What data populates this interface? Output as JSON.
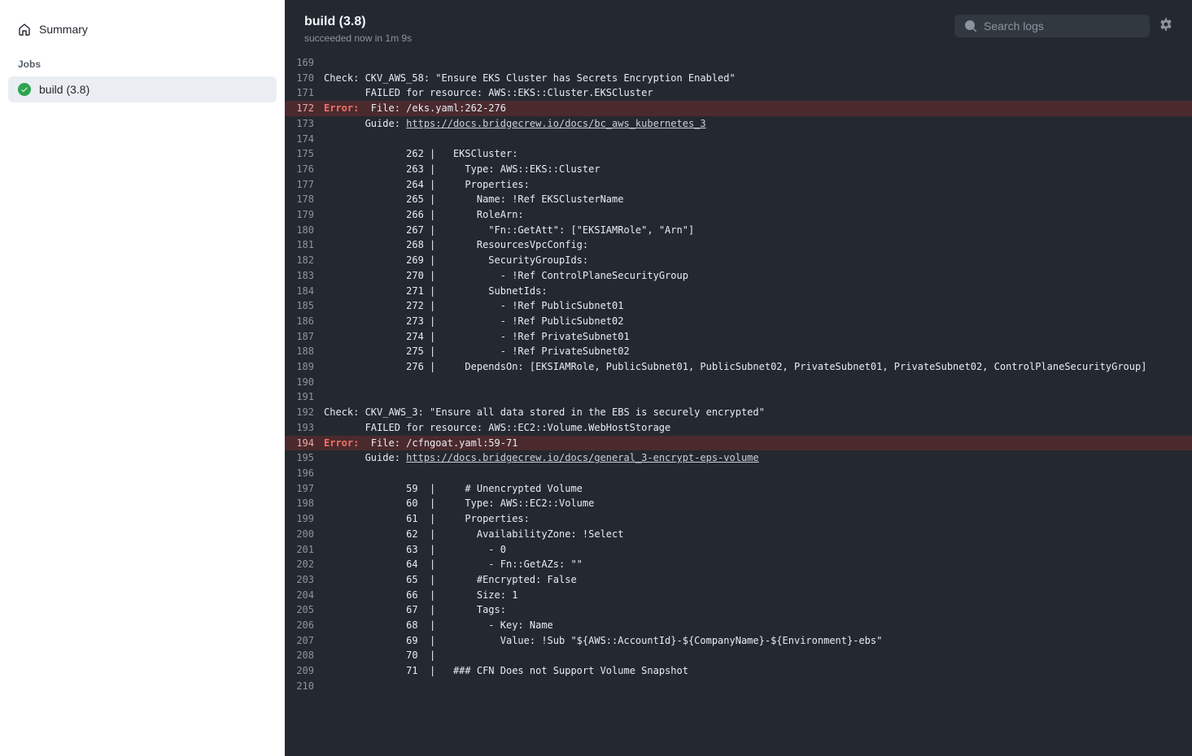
{
  "sidebar": {
    "summary_label": "Summary",
    "jobs_heading": "Jobs",
    "job_label": "build (3.8)"
  },
  "header": {
    "title": "build (3.8)",
    "status_word": "succeeded",
    "status_rest": " now in 1m 9s"
  },
  "search": {
    "placeholder": "Search logs"
  },
  "log_lines": [
    {
      "n": 169,
      "t": ""
    },
    {
      "n": 170,
      "t": "Check: CKV_AWS_58: \"Ensure EKS Cluster has Secrets Encryption Enabled\""
    },
    {
      "n": 171,
      "t": "       FAILED for resource: AWS::EKS::Cluster.EKSCluster"
    },
    {
      "n": 172,
      "err": true,
      "t": "  File: /eks.yaml:262-276"
    },
    {
      "n": 173,
      "t": "       Guide: ",
      "link": "https://docs.bridgecrew.io/docs/bc_aws_kubernetes_3"
    },
    {
      "n": 174,
      "t": ""
    },
    {
      "n": 175,
      "t": "              262 |   EKSCluster:"
    },
    {
      "n": 176,
      "t": "              263 |     Type: AWS::EKS::Cluster"
    },
    {
      "n": 177,
      "t": "              264 |     Properties:"
    },
    {
      "n": 178,
      "t": "              265 |       Name: !Ref EKSClusterName"
    },
    {
      "n": 179,
      "t": "              266 |       RoleArn:"
    },
    {
      "n": 180,
      "t": "              267 |         \"Fn::GetAtt\": [\"EKSIAMRole\", \"Arn\"]"
    },
    {
      "n": 181,
      "t": "              268 |       ResourcesVpcConfig:"
    },
    {
      "n": 182,
      "t": "              269 |         SecurityGroupIds:"
    },
    {
      "n": 183,
      "t": "              270 |           - !Ref ControlPlaneSecurityGroup"
    },
    {
      "n": 184,
      "t": "              271 |         SubnetIds:"
    },
    {
      "n": 185,
      "t": "              272 |           - !Ref PublicSubnet01"
    },
    {
      "n": 186,
      "t": "              273 |           - !Ref PublicSubnet02"
    },
    {
      "n": 187,
      "t": "              274 |           - !Ref PrivateSubnet01"
    },
    {
      "n": 188,
      "t": "              275 |           - !Ref PrivateSubnet02"
    },
    {
      "n": 189,
      "t": "              276 |     DependsOn: [EKSIAMRole, PublicSubnet01, PublicSubnet02, PrivateSubnet01, PrivateSubnet02, ControlPlaneSecurityGroup]"
    },
    {
      "n": 190,
      "t": ""
    },
    {
      "n": 191,
      "t": ""
    },
    {
      "n": 192,
      "t": "Check: CKV_AWS_3: \"Ensure all data stored in the EBS is securely encrypted\""
    },
    {
      "n": 193,
      "t": "       FAILED for resource: AWS::EC2::Volume.WebHostStorage"
    },
    {
      "n": 194,
      "err": true,
      "t": "  File: /cfngoat.yaml:59-71"
    },
    {
      "n": 195,
      "t": "       Guide: ",
      "link": "https://docs.bridgecrew.io/docs/general_3-encrypt-eps-volume"
    },
    {
      "n": 196,
      "t": ""
    },
    {
      "n": 197,
      "t": "              59  |     # Unencrypted Volume"
    },
    {
      "n": 198,
      "t": "              60  |     Type: AWS::EC2::Volume"
    },
    {
      "n": 199,
      "t": "              61  |     Properties:"
    },
    {
      "n": 200,
      "t": "              62  |       AvailabilityZone: !Select"
    },
    {
      "n": 201,
      "t": "              63  |         - 0"
    },
    {
      "n": 202,
      "t": "              64  |         - Fn::GetAZs: \"\""
    },
    {
      "n": 203,
      "t": "              65  |       #Encrypted: False"
    },
    {
      "n": 204,
      "t": "              66  |       Size: 1"
    },
    {
      "n": 205,
      "t": "              67  |       Tags:"
    },
    {
      "n": 206,
      "t": "              68  |         - Key: Name"
    },
    {
      "n": 207,
      "t": "              69  |           Value: !Sub \"${AWS::AccountId}-${CompanyName}-${Environment}-ebs\""
    },
    {
      "n": 208,
      "t": "              70  | "
    },
    {
      "n": 209,
      "t": "              71  |   ### CFN Does not Support Volume Snapshot"
    },
    {
      "n": 210,
      "t": ""
    }
  ],
  "error_label": "Error:"
}
